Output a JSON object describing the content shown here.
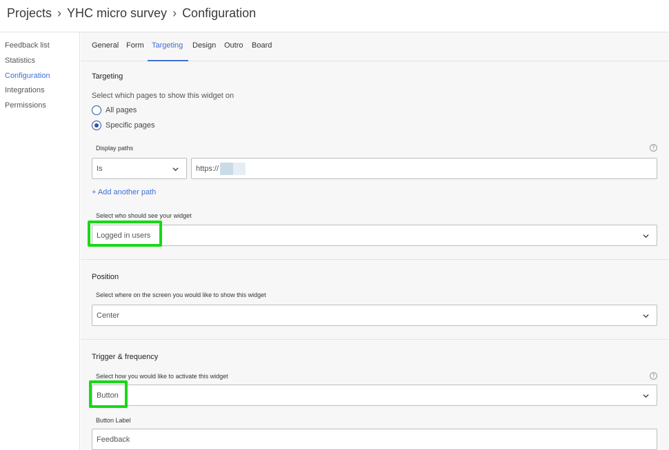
{
  "breadcrumb": {
    "items": [
      "Projects",
      "YHC micro survey",
      "Configuration"
    ],
    "separator": "›"
  },
  "sidebar": {
    "items": [
      {
        "label": "Feedback list",
        "active": false
      },
      {
        "label": "Statistics",
        "active": false
      },
      {
        "label": "Configuration",
        "active": true
      },
      {
        "label": "Integrations",
        "active": false
      },
      {
        "label": "Permissions",
        "active": false
      }
    ]
  },
  "tabs": {
    "items": [
      "General",
      "Form",
      "Targeting",
      "Design",
      "Outro",
      "Board"
    ],
    "active": "Targeting"
  },
  "targeting": {
    "title": "Targeting",
    "pages_question": "Select which pages to show this widget on",
    "option_all": "All pages",
    "option_specific": "Specific pages",
    "selected_option": "Specific pages",
    "display_paths_label": "Display paths",
    "path_operator": "Is",
    "path_value": "https://",
    "add_path": "+ Add another path",
    "audience_label": "Select who should see your widget",
    "audience_value": "Logged in users"
  },
  "position": {
    "title": "Position",
    "label": "Select where on the screen you would like to show this widget",
    "value": "Center"
  },
  "trigger": {
    "title": "Trigger & frequency",
    "label": "Select how you would like to activate this widget",
    "value": "Button",
    "button_label_title": "Button Label",
    "button_label_placeholder": "Feedback"
  },
  "icons": {
    "help": "?",
    "help_icon": "help-circle-icon",
    "chevron_icon": "chevron-down-icon"
  },
  "colors": {
    "accent": "#3d6fd6",
    "highlight": "#16d916",
    "radio": "#2c53a8"
  }
}
